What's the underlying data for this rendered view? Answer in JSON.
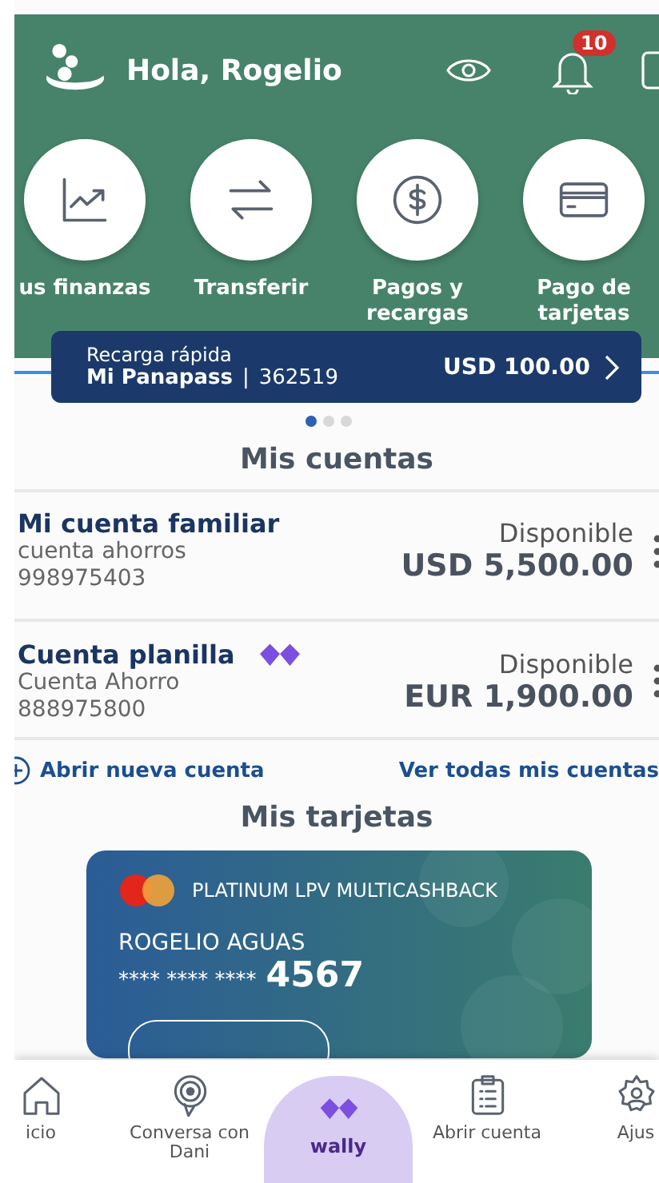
{
  "header": {
    "greeting": "Hola, Rogelio",
    "notifications": "10"
  },
  "quick_actions": [
    {
      "kind": "chart",
      "label": "us finanzas"
    },
    {
      "kind": "transfer",
      "label": "Transferir"
    },
    {
      "kind": "dollar",
      "label": "Pagos y recargas"
    },
    {
      "kind": "card",
      "label": "Pago de tarjetas"
    }
  ],
  "quick_recharge": {
    "title": "Recarga rápida",
    "name": "Mi Panapass",
    "separator": "|",
    "number": "362519",
    "amount": "USD 100.00"
  },
  "carousel_dots": [
    {
      "selected": true
    },
    {
      "selected": false
    },
    {
      "selected": false
    }
  ],
  "accounts": {
    "title": "Mis cuentas",
    "items": [
      {
        "name": "Mi cuenta familiar",
        "wally": false,
        "type": "cuenta ahorros",
        "number": "998975403",
        "balance_label": "Disponible",
        "balance": "USD 5,500.00"
      },
      {
        "name": "Cuenta planilla",
        "wally": true,
        "type": "Cuenta Ahorro",
        "number": "888975800",
        "balance_label": "Disponible",
        "balance": "EUR 1,900.00"
      }
    ],
    "open_link": "Abrir nueva cuenta",
    "all_link": "Ver todas mis cuentas"
  },
  "cards": {
    "title": "Mis tarjetas",
    "items": [
      {
        "product": "PLATINUM LPV MULTICASHBACK",
        "holder": "ROGELIO AGUAS",
        "masked": "**** **** ****",
        "last4": "4567"
      }
    ]
  },
  "bottom_nav": [
    {
      "kind": "home",
      "label": "icio",
      "selected": false
    },
    {
      "kind": "chat",
      "label": "Conversa con Dani",
      "selected": false
    },
    {
      "kind": "wally",
      "label": "wally",
      "selected": true
    },
    {
      "kind": "clipboard",
      "label": "Abrir cuenta",
      "selected": false
    },
    {
      "kind": "gear",
      "label": "Ajus",
      "selected": false
    }
  ]
}
